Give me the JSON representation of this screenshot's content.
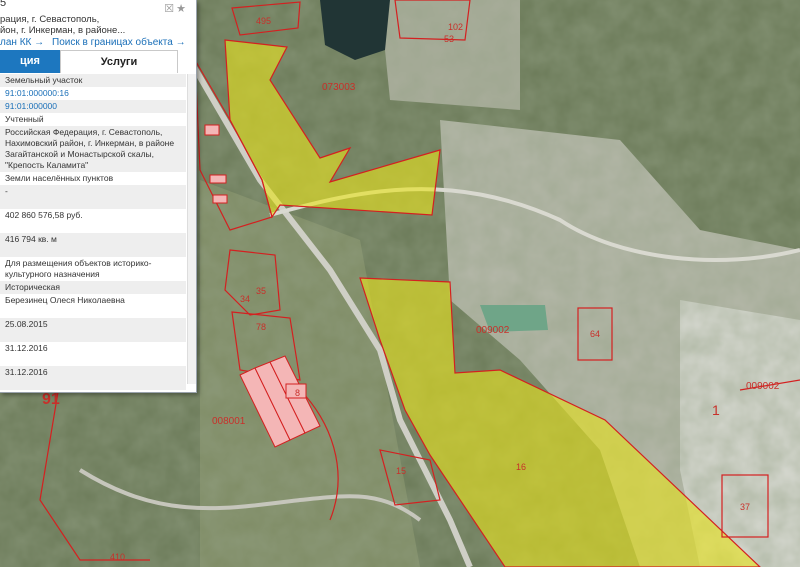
{
  "panel": {
    "number_fragment": "5",
    "address_line1": "рация, г. Севастополь,",
    "address_line2": "йон, г. Инкерман, в районе...",
    "link_plan": "лан КК →",
    "link_search": "Поиск в границах объекта →",
    "tab_info": "ция",
    "tab_services": "Услуги",
    "rows": [
      {
        "text": "Земельный участок",
        "shade": true,
        "link": false
      },
      {
        "text": "91:01:000000:16",
        "shade": false,
        "link": true
      },
      {
        "text": "91:01:000000",
        "shade": true,
        "link": true
      },
      {
        "text": "Учтенный",
        "shade": false,
        "link": false
      },
      {
        "text": "Российская Федерация, г. Севастополь, Нахимовский район, г. Инкерман, в районе Загайтанской и Монастырской скалы, \"Крепость Каламита\"",
        "shade": true,
        "link": false
      },
      {
        "text": "Земли населённых пунктов",
        "shade": false,
        "link": false
      },
      {
        "text": "-",
        "shade": true,
        "link": false
      },
      {
        "text": "402 860 576,58 руб.",
        "shade": false,
        "link": false
      },
      {
        "text": "416 794 кв. м",
        "shade": true,
        "link": false
      },
      {
        "text": "Для размещения объектов историко-культурного назначения",
        "shade": false,
        "link": false
      },
      {
        "text": "Историческая",
        "shade": true,
        "link": false
      },
      {
        "text": "Березинец Олеся Николаевна",
        "shade": false,
        "link": false
      },
      {
        "text": "25.08.2015",
        "shade": true,
        "link": false
      },
      {
        "text": "31.12.2016",
        "shade": false,
        "link": false
      },
      {
        "text": "31.12.2016",
        "shade": true,
        "link": false
      }
    ]
  },
  "map_labels": {
    "q_073003": "073003",
    "q_009002_a": "009002",
    "q_009002_b": "009002",
    "q_008001": "008001",
    "p_495": "495",
    "p_102": "102",
    "p_53": "53",
    "p_64": "64",
    "p_16": "16",
    "p_37": "37",
    "p_15": "15",
    "p_78": "78",
    "p_34": "34",
    "p_35": "35",
    "p_8": "8",
    "p_1": "1",
    "p_410": "410",
    "p_91": "91"
  },
  "colors": {
    "highlight_fill": "#e6e21f",
    "parcel_stroke": "#d42020",
    "tab_active": "#1d77bf",
    "link": "#1a6fb8"
  }
}
